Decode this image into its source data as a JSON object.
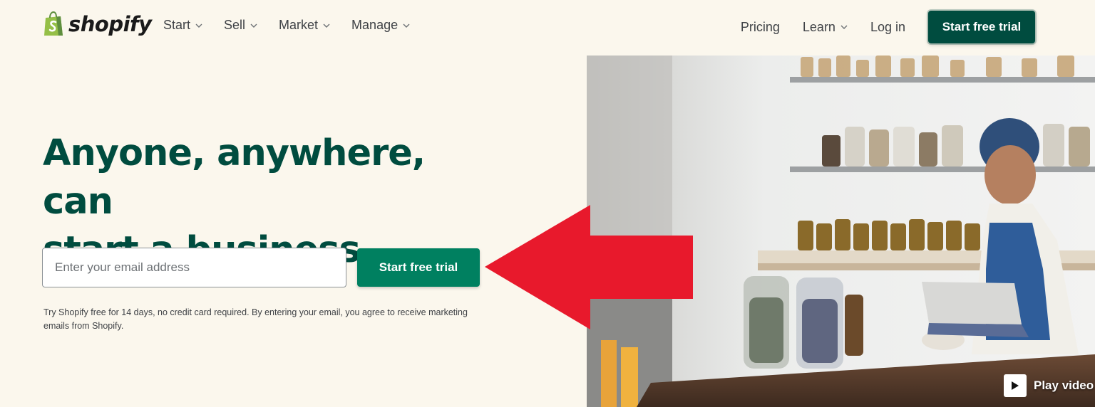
{
  "header": {
    "logo_text": "shopify",
    "nav_left": [
      {
        "label": "Start"
      },
      {
        "label": "Sell"
      },
      {
        "label": "Market"
      },
      {
        "label": "Manage"
      }
    ],
    "nav_right": {
      "pricing": "Pricing",
      "learn": "Learn",
      "login": "Log in",
      "cta": "Start free trial"
    }
  },
  "hero": {
    "headline_line1": "Anyone, anywhere, can",
    "headline_line2": "start a business",
    "email_placeholder": "Enter your email address",
    "cta": "Start free trial",
    "disclaimer": "Try Shopify free for 14 days, no credit card required. By entering your email, you agree to receive marketing emails from Shopify."
  },
  "media": {
    "play_label": "Play video"
  },
  "colors": {
    "background": "#fbf7ed",
    "brand_dark": "#004c3f",
    "brand_green": "#008060",
    "annotation_arrow": "#e8192c"
  }
}
